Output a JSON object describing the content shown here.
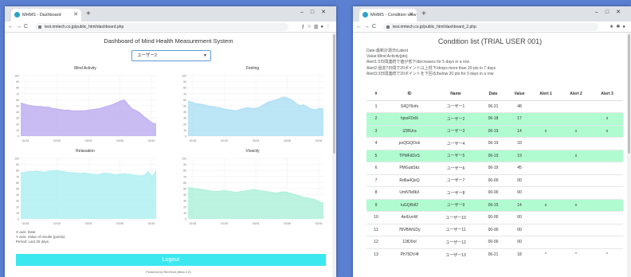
{
  "window1": {
    "tab_title": "MHMS - Dashboard",
    "url": "test.rimtech.co.jp/public_html/dashboard.php",
    "page_title": "Dashboard of Mind Health Measurement System",
    "user_select": "ユーザー2",
    "charts": [
      {
        "title": "Mind Activity",
        "values": [
          55,
          53,
          51,
          50,
          49,
          49,
          48,
          48,
          46,
          45,
          44,
          43,
          43,
          42,
          42,
          42,
          42,
          43,
          44,
          45,
          46,
          48,
          50,
          52,
          55,
          58,
          60,
          52,
          45,
          42,
          38,
          32,
          27,
          22,
          20
        ],
        "color": "#b7a6ee"
      },
      {
        "title": "Feeling",
        "values": [
          58,
          56,
          54,
          53,
          52,
          50,
          49,
          48,
          47,
          45,
          44,
          43,
          42,
          44,
          46,
          47,
          46,
          46,
          48,
          52,
          56,
          58,
          60,
          62,
          65,
          63,
          60,
          55,
          50,
          52,
          48,
          45,
          44,
          46,
          45
        ],
        "color": "#a6dcf2"
      },
      {
        "title": "Relaxation",
        "values": [
          76,
          77,
          78,
          78,
          79,
          78,
          77,
          79,
          80,
          80,
          79,
          78,
          77,
          76,
          76,
          75,
          76,
          75,
          74,
          73,
          74,
          76,
          75,
          74,
          73,
          74,
          75,
          74,
          73,
          72,
          71,
          72,
          78,
          70,
          80
        ],
        "color": "#a6eef0"
      },
      {
        "title": "Vivacity",
        "values": [
          52,
          51,
          50,
          49,
          48,
          47,
          46,
          45,
          46,
          47,
          46,
          45,
          44,
          45,
          46,
          47,
          48,
          48,
          47,
          46,
          45,
          44,
          43,
          44,
          45,
          44,
          42,
          40,
          38,
          36,
          35,
          33,
          32,
          28,
          26
        ],
        "color": "#a6efd6"
      }
    ],
    "chart_data": {
      "type": "area",
      "x_ticks": [
        "02/18",
        "02/25",
        "03/03",
        "03/08",
        "03/16"
      ],
      "y_ticks": [
        "0",
        "10",
        "20",
        "30",
        "40",
        "50",
        "60",
        "70",
        "80",
        "90",
        "100"
      ],
      "ylim": [
        0,
        100
      ]
    },
    "legend_lines": [
      "X axis: Date",
      "Y axis: Value of results (points)",
      "Period: Last 30 days"
    ],
    "logout_label": "Logout",
    "footer": "Powered by RimTech (Beta 2.0)"
  },
  "window2": {
    "tab_title": "MHMS - Condition view",
    "url": "test.rimtech.co.jp/public_html/dashboard_2.php",
    "page_title": "Condition list (TRIAL USER 001)",
    "desc_lines": [
      "Date:最新計測日/Latest",
      "Value:Mind Activity(pts)",
      "Alert1:5日間連続で値が低下/decreases for 5 days in a row",
      "Alert2:過去7日間で20ポイント以上低下/drops more than 20 pts in 7 days",
      "Alert3:3日間連続で20ポイントを下回る/below 20 pts for 3 days in a row"
    ],
    "columns": [
      "#",
      "ID",
      "Name",
      "Date",
      "Value",
      "Alert 1",
      "Alert 2",
      "Alert 3"
    ],
    "rows": [
      {
        "n": "1",
        "id": "S4Q76ofo",
        "name": "ユーザー1",
        "date": "06-21",
        "value": "48",
        "a1": "",
        "a2": "",
        "a3": "",
        "hl": false
      },
      {
        "n": "2",
        "id": "hjooFDdX",
        "name": "ユーザー2",
        "date": "06-18",
        "value": "17",
        "a1": "",
        "a2": "",
        "a3": "x",
        "hl": true
      },
      {
        "n": "3",
        "id": "IZIBUra",
        "name": "ユーザー3",
        "date": "06-19",
        "value": "14",
        "a1": "x",
        "a2": "x",
        "a3": "x",
        "hl": true
      },
      {
        "n": "4",
        "id": "poQGQOok",
        "name": "ユーザー4",
        "date": "06-19",
        "value": "33",
        "a1": "",
        "a2": "",
        "a3": "",
        "hl": false
      },
      {
        "n": "5",
        "id": "TPMFdDzS",
        "name": "ユーザー5",
        "date": "06-19",
        "value": "19",
        "a1": "",
        "a2": "x",
        "a3": "",
        "hl": true
      },
      {
        "n": "6",
        "id": "PMGubSkz",
        "name": "ユーザー6",
        "date": "06-19",
        "value": "45",
        "a1": "",
        "a2": "",
        "a3": "",
        "hl": false
      },
      {
        "n": "7",
        "id": "Rd6a4QeQ",
        "name": "ユーザー7",
        "date": "00-00",
        "value": "00",
        "a1": "",
        "a2": "",
        "a3": "",
        "hl": false
      },
      {
        "n": "8",
        "id": "UmNTe8kX",
        "name": "ユーザー8",
        "date": "00-00",
        "value": "00",
        "a1": "",
        "a2": "",
        "a3": "",
        "hl": false
      },
      {
        "n": "9",
        "id": "luGQRdl2",
        "name": "ユーザー9",
        "date": "06-15",
        "value": "14",
        "a1": "x",
        "a2": "x",
        "a3": "",
        "hl": true
      },
      {
        "n": "10",
        "id": "AelUvoW",
        "name": "ユーザー10",
        "date": "00-00",
        "value": "00",
        "a1": "",
        "a2": "",
        "a3": "",
        "hl": false
      },
      {
        "n": "11",
        "id": "78VBWGDy",
        "name": "ユーザー11",
        "date": "00-00",
        "value": "00",
        "a1": "",
        "a2": "",
        "a3": "",
        "hl": false
      },
      {
        "n": "12",
        "id": "12tD0oI",
        "name": "ユーザー12",
        "date": "00-00",
        "value": "00",
        "a1": "",
        "a2": "",
        "a3": "",
        "hl": false
      },
      {
        "n": "13",
        "id": "Ph75DV4f",
        "name": "ユーザー13",
        "date": "06-21",
        "value": "18",
        "a1": "*",
        "a2": "*",
        "a3": "*",
        "hl": false
      }
    ]
  }
}
